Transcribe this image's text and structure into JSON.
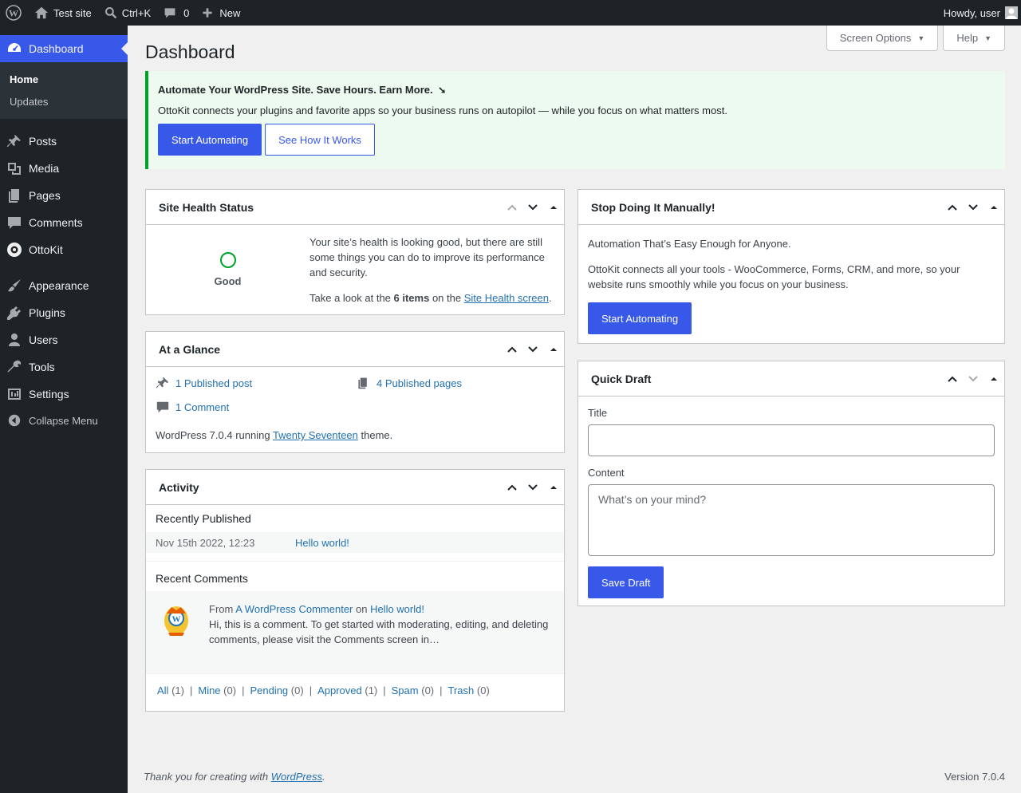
{
  "adminbar": {
    "site_name": "Test site",
    "search_shortcut": "Ctrl+K",
    "comments_count": "0",
    "new_label": "New",
    "howdy": "Howdy, user"
  },
  "sidebar": {
    "dashboard": "Dashboard",
    "submenu": [
      "Home",
      "Updates"
    ],
    "items": [
      "Posts",
      "Media",
      "Pages",
      "Comments",
      "OttoKit",
      "Appearance",
      "Plugins",
      "Users",
      "Tools",
      "Settings"
    ],
    "collapse": "Collapse Menu"
  },
  "screen_meta": {
    "screen_options": "Screen Options",
    "help": "Help"
  },
  "page_title": "Dashboard",
  "notice": {
    "title": "Automate Your WordPress Site. Save Hours. Earn More.",
    "text": "OttoKit connects your plugins and favorite apps so your business runs on autopilot — while you focus on what matters most.",
    "primary": "Start Automating",
    "secondary": "See How It Works"
  },
  "site_health": {
    "title": "Site Health Status",
    "status": "Good",
    "text": "Your site’s health is looking good, but there are still some things you can do to improve its performance and security.",
    "take_look_pre": "Take a look at the ",
    "items": "6 items",
    "take_look_mid": " on the ",
    "link": "Site Health screen",
    "take_look_post": "."
  },
  "glance": {
    "title": "At a Glance",
    "posts": "1 Published post",
    "pages": "4 Published pages",
    "comments": "1 Comment",
    "version_pre": "WordPress 7.0.4 running ",
    "theme": "Twenty Seventeen",
    "version_post": " theme."
  },
  "activity": {
    "title": "Activity",
    "recently_published": "Recently Published",
    "pub_date": "Nov 15th 2022, 12:23",
    "pub_title": "Hello world!",
    "recent_comments": "Recent Comments",
    "from": "From ",
    "commenter": "A WordPress Commenter",
    "on": " on ",
    "comment_post": "Hello world!",
    "comment_excerpt": "Hi, this is a comment. To get started with moderating, editing, and deleting comments, please visit the Comments screen in…",
    "filters": [
      {
        "label": "All",
        "count": "(1)"
      },
      {
        "label": "Mine",
        "count": "(0)"
      },
      {
        "label": "Pending",
        "count": "(0)"
      },
      {
        "label": "Approved",
        "count": "(1)"
      },
      {
        "label": "Spam",
        "count": "(0)"
      },
      {
        "label": "Trash",
        "count": "(0)"
      }
    ]
  },
  "ottokit_widget": {
    "title": "Stop Doing It Manually!",
    "tagline": "Automation That’s Easy Enough for Anyone.",
    "text": "OttoKit connects all your tools - WooCommerce, Forms, CRM, and more, so your website runs smoothly while you focus on your business.",
    "button": "Start Automating"
  },
  "quick_draft": {
    "title": "Quick Draft",
    "title_label": "Title",
    "title_value": "",
    "content_label": "Content",
    "content_placeholder": "What’s on your mind?",
    "button": "Save Draft"
  },
  "footer": {
    "thanks_pre": "Thank you for creating with ",
    "wordpress": "WordPress",
    "thanks_post": ".",
    "version": "Version 7.0.4"
  },
  "colors": {
    "accent": "#3858e9",
    "adminbar": "#1d2327",
    "success": "#00a32a",
    "link": "#2271b1"
  }
}
